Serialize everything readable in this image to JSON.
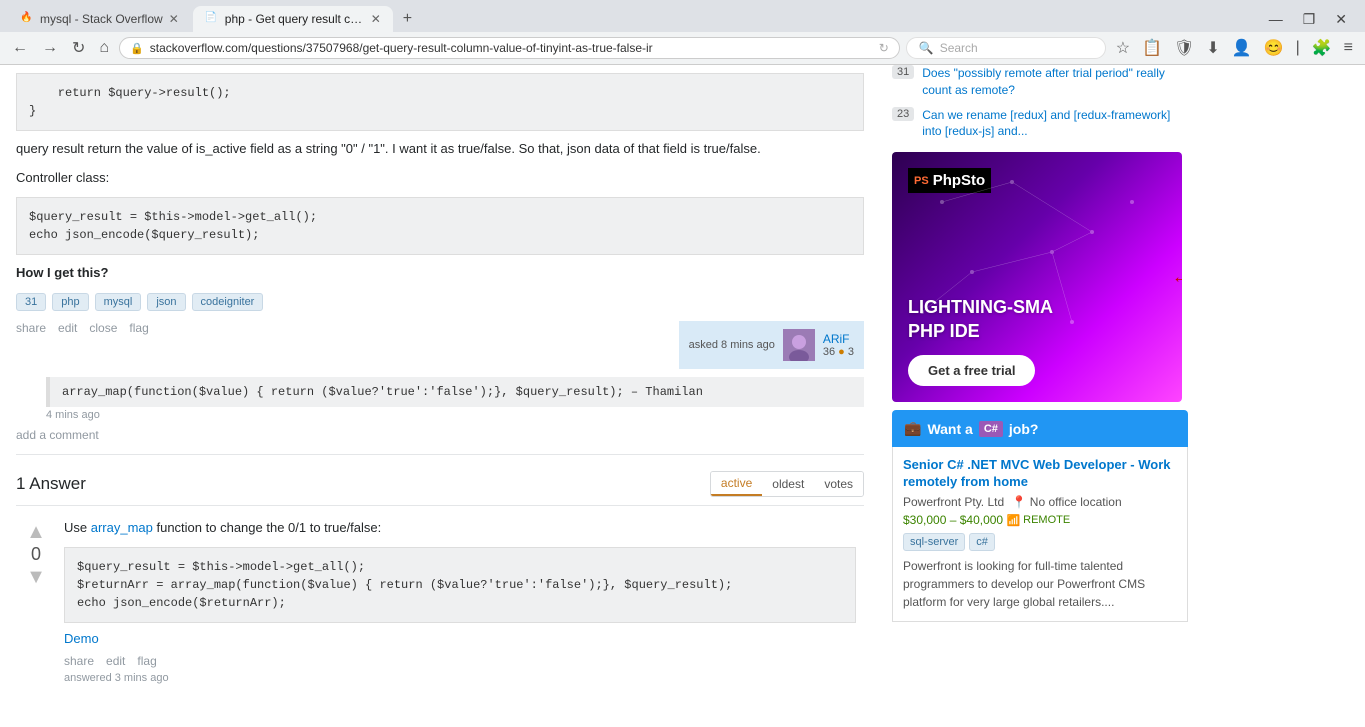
{
  "browser": {
    "tabs": [
      {
        "id": "tab1",
        "title": "mysql - Stack Overflow",
        "favicon": "🔥",
        "active": false
      },
      {
        "id": "tab2",
        "title": "php - Get query result col...",
        "favicon": "📄",
        "active": true
      }
    ],
    "new_tab_label": "+",
    "window_controls": [
      "—",
      "❐",
      "✕"
    ],
    "url": "stackoverflow.com/questions/37507968/get-query-result-column-value-of-tinyint-as-true-false-ir",
    "search_placeholder": "Search",
    "nav_back": "←",
    "nav_forward": "→",
    "refresh": "↻",
    "home": "⌂"
  },
  "question": {
    "code_top": "    return $query->result();\n}",
    "body_text": "query result return the value of is_active field as a string \"0\" / \"1\". I want it as true/false. So that, json data of that field is true/false.",
    "controller_label": "Controller class:",
    "code_controller": "$query_result = $this->model->get_all();\necho json_encode($query_result);",
    "how_label": "How I get this?",
    "tags": [
      "php",
      "mysql",
      "json",
      "codeigniter"
    ],
    "actions": [
      "share",
      "edit",
      "close",
      "flag"
    ],
    "asked_time": "asked 8 mins ago",
    "user_name": "ARiF",
    "user_rep": "36",
    "user_badge_silver": "●",
    "user_badge_bronze": "3",
    "comment_code": "array_map(function($value) { return ($value?'true':'false');}, $query_result); – Thamilan",
    "comment_time": "4 mins ago",
    "add_comment": "add a comment"
  },
  "answers": {
    "count_label": "1 Answer",
    "tabs": [
      "active",
      "oldest",
      "votes"
    ],
    "active_tab": "active",
    "items": [
      {
        "vote_count": "0",
        "text_before": "Use ",
        "link_text": "array_map",
        "text_after": " function to change the 0/1 to true/false:",
        "code": "$query_result = $this->model->get_all();\n$returnArr = array_map(function($value) { return ($value?'true':'false');}, $query_result);\necho json_encode($returnArr);",
        "demo_label": "Demo",
        "actions": [
          "share",
          "edit",
          "flag"
        ],
        "answered_time": "answered 3 mins ago"
      }
    ]
  },
  "sidebar": {
    "related_questions": [
      {
        "count": "31",
        "text": "Does \"possibly remote after trial period\" really count as remote?"
      },
      {
        "count": "23",
        "text": "Can we rename [redux] and [redux-framework] into [redux-js] and..."
      }
    ],
    "ad": {
      "logo": "PhpSto",
      "logo_prefix": "PS",
      "tagline": "LIGHTNING-SMA\nPHP IDE",
      "cta": "Get a free trial"
    },
    "jobs": {
      "header": "Want a C# job?",
      "listing": {
        "title": "Senior C# .NET MVC Web Developer - Work remotely from home",
        "company": "Powerfront Pty. Ltd",
        "location": "No office location",
        "salary": "$30,000 – $40,000",
        "remote_label": "REMOTE",
        "skills": [
          "sql-server",
          "c#"
        ],
        "description": "Powerfront is looking for full-time talented programmers to develop our Powerfront CMS platform for very large global retailers...."
      }
    }
  }
}
